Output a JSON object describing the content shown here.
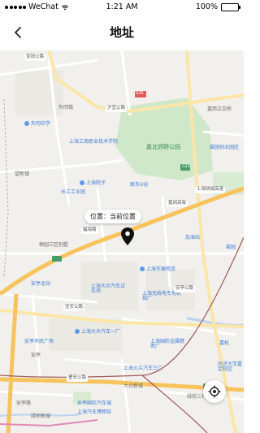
{
  "status_bar": {
    "carrier": "WeChat",
    "time": "1:21 AM",
    "battery_percent": "100%",
    "battery_level": 1.0
  },
  "nav": {
    "title": "地址",
    "back_icon": "chevron-left-icon"
  },
  "map": {
    "current_location_label": "位置：当前位置",
    "locate_icon": "crosshair-locate-icon",
    "pin_icon": "location-pin-icon",
    "labels": {
      "baosheng_rd_top": "宝钱公路",
      "huyi_rd": "沪宜公路",
      "waigang_town": "外冈镇",
      "waigang_middle_school": "外冈中学",
      "jiading_park": "嘉北郊野公园",
      "huxi_town": "嘉西立交桥",
      "juyuan_park": "菊园创业园区",
      "gongshang_school": "上海工商职业技术学院",
      "wanghua_industrial": "望新镇",
      "shanghai_yard": "上海院子",
      "changjiang_industrial": "长江工业园",
      "lianzhong_u": "联东U谷",
      "jiamin_hwy": "嘉闵高架",
      "jiayu_rd": "上海绕城高速",
      "fuhe_rd": "福海路",
      "meiyuan_villa": "梅园三区别墅",
      "gas_station": "加油站",
      "jujing_park": "菊园",
      "anting_north": "安亭北站",
      "shanghai_junlong": "上海军泰物流",
      "dazhong_test": "上海大众汽车试车场",
      "shanghai_wuxian": "上海无线电专用机械厂",
      "anting_rd": "宝安公路",
      "anting_park": "安亭公路",
      "anting_city_hospital": "安亭市民广场",
      "dazhong_factory_1": "上海大众汽车一厂",
      "shanghai_guofang": "上海国防金属精密厂",
      "jiasong": "嘉松",
      "anting_town": "安亭",
      "dazhong_factory_3": "上海大众汽车三厂",
      "caoan_rd": "曹安公路",
      "dazhong_newcity": "大众新城",
      "lvyuan_park": "绿苑三村二期",
      "anting_intl": "安亭国际汽车城",
      "shanghai_car": "上海汽车博物馆",
      "jiading_tongji": "同济大学嘉定校区",
      "luxinsanlu": "绿地新城",
      "anting_road": "安亭路",
      "road_s26": "S26",
      "road_g15": "G15",
      "road_s5": "S5"
    }
  }
}
